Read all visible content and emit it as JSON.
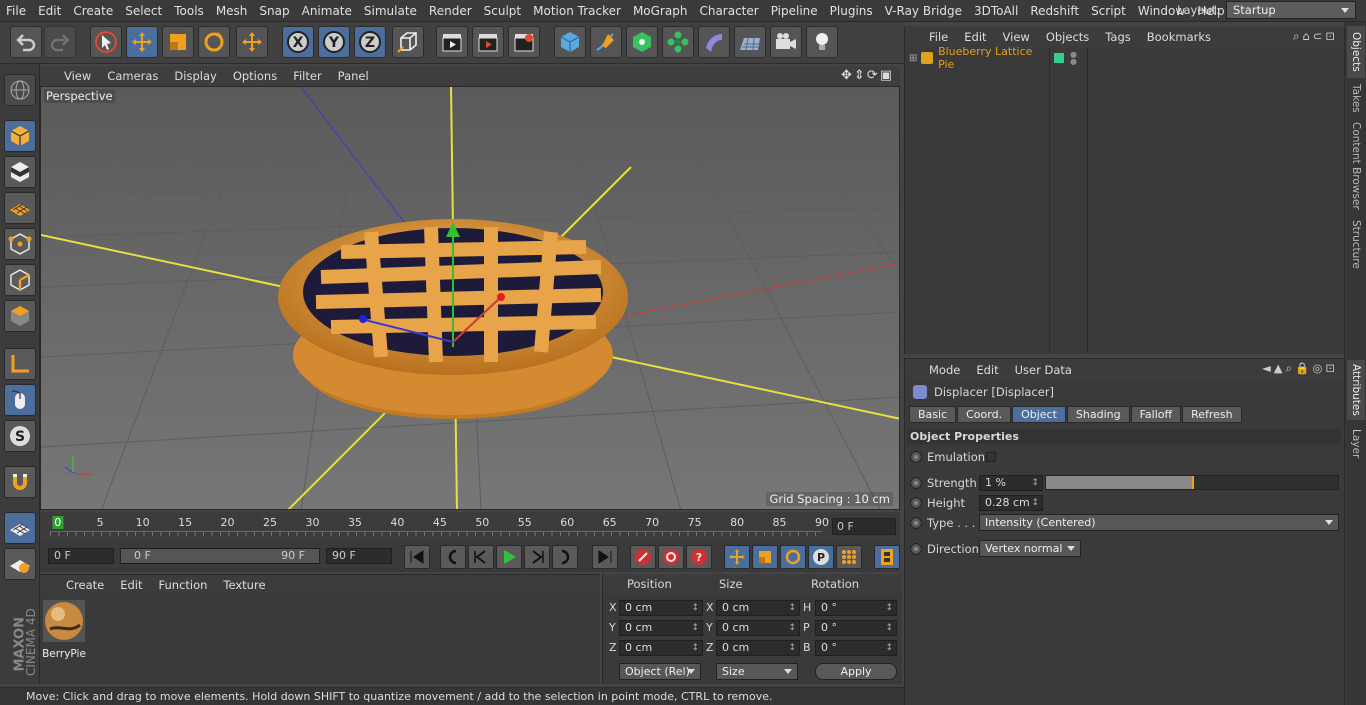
{
  "menu": [
    "File",
    "Edit",
    "Create",
    "Select",
    "Tools",
    "Mesh",
    "Snap",
    "Animate",
    "Simulate",
    "Render",
    "Sculpt",
    "Motion Tracker",
    "MoGraph",
    "Character",
    "Pipeline",
    "Plugins",
    "V-Ray Bridge",
    "3DToAll",
    "Redshift",
    "Script",
    "Window",
    "Help"
  ],
  "layout": {
    "label": "Layout:",
    "value": "Startup"
  },
  "viewport": {
    "menu": [
      "View",
      "Cameras",
      "Display",
      "Options",
      "Filter",
      "Panel"
    ],
    "label": "Perspective",
    "grid_spacing": "Grid Spacing : 10 cm"
  },
  "timeline": {
    "ticks": [
      "0",
      "5",
      "10",
      "15",
      "20",
      "25",
      "30",
      "35",
      "40",
      "45",
      "50",
      "55",
      "60",
      "65",
      "70",
      "75",
      "80",
      "85",
      "90"
    ],
    "current_frame": "0 F"
  },
  "transport": {
    "start": "0 F",
    "range_start": "0 F",
    "range_end": "90 F",
    "end": "90 F"
  },
  "material_manager": {
    "menu": [
      "Create",
      "Edit",
      "Function",
      "Texture"
    ],
    "materials": [
      {
        "name": "BerryPie"
      }
    ]
  },
  "coordinates": {
    "headers": {
      "position": "Position",
      "size": "Size",
      "rotation": "Rotation"
    },
    "rows": [
      {
        "pl": "X",
        "pv": "0 cm",
        "sl": "X",
        "sv": "0 cm",
        "rl": "H",
        "rv": "0 °"
      },
      {
        "pl": "Y",
        "pv": "0 cm",
        "sl": "Y",
        "sv": "0 cm",
        "rl": "P",
        "rv": "0 °"
      },
      {
        "pl": "Z",
        "pv": "0 cm",
        "sl": "Z",
        "sv": "0 cm",
        "rl": "B",
        "rv": "0 °"
      }
    ],
    "mode": "Object (Rel)",
    "size_mode": "Size",
    "apply": "Apply"
  },
  "object_manager": {
    "menu": [
      "File",
      "Edit",
      "View",
      "Objects",
      "Tags",
      "Bookmarks"
    ],
    "objects": [
      {
        "name": "Blueberry Lattice Pie",
        "color": "#e0a020"
      }
    ]
  },
  "attributes": {
    "menu": [
      "Mode",
      "Edit",
      "User Data"
    ],
    "object_title": "Displacer [Displacer]",
    "tabs": [
      "Basic",
      "Coord.",
      "Object",
      "Shading",
      "Falloff",
      "Refresh"
    ],
    "active_tab": "Object",
    "section": "Object Properties",
    "emulation_label": "Emulation",
    "strength_label": "Strength",
    "strength_value": "1 %",
    "strength_fraction": 0.01,
    "height_label": "Height",
    "height_value": "0.28 cm",
    "type_label": "Type . . .",
    "type_value": "Intensity (Centered)",
    "direction_label": "Direction",
    "direction_value": "Vertex normal"
  },
  "right_tabs": [
    "Objects",
    "Takes",
    "Content Browser",
    "Structure",
    "Attributes",
    "Layer"
  ],
  "brand": {
    "line1": "MAXON",
    "line2": "CINEMA 4D"
  },
  "status": "Move: Click and drag to move elements. Hold down SHIFT to quantize movement / add to the selection in point mode, CTRL to remove."
}
